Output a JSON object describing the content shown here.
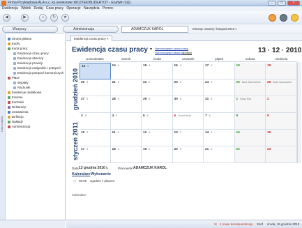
{
  "window": {
    "title": "Firma Przykładowa ALA s.c. ks.serwisowe WOJTEK\\BUDERTOT - EnaWin SQL",
    "buttons": [
      "_",
      "□",
      "×"
    ]
  },
  "menu": {
    "items": [
      "Ewidencja",
      "Widok",
      "Dodaj",
      "Czas pracy",
      "Operacje",
      "Narzędzia",
      "Pomoc"
    ]
  },
  "addressbar": {
    "left_pill": "Wszyscy",
    "section": "Administracja",
    "person": "ADAMCZUK KAROL",
    "period_label": "Miesiąc otwarty: listopad 2010 r."
  },
  "sidebar": {
    "items": [
      {
        "label": "Strona główna",
        "level": 0
      },
      {
        "label": "Kadry",
        "level": 0
      },
      {
        "label": "Karta pracy",
        "level": 0
      },
      {
        "label": "Ewidencja czasu pracy",
        "level": 1
      },
      {
        "label": "Ewidencja absencji",
        "level": 1
      },
      {
        "label": "Ewidencja prowizji",
        "level": 1
      },
      {
        "label": "Ewidencja nadgodzin i potrąceń",
        "level": 1
      },
      {
        "label": "Ewidencja potrąceń komorniczych",
        "level": 1
      },
      {
        "label": "Płace",
        "level": 0
      },
      {
        "label": "Wypłaty",
        "level": 1
      },
      {
        "label": "Rachunki",
        "level": 1
      },
      {
        "label": "Ewidencje dodatkowe",
        "level": 0
      },
      {
        "label": "Finanse",
        "level": 0
      },
      {
        "label": "Kartoteki",
        "level": 0
      },
      {
        "label": "Deklaracje",
        "level": 0
      },
      {
        "label": "Zestawienia",
        "level": 0
      },
      {
        "label": "Definicje",
        "level": 0
      },
      {
        "label": "Nakłady",
        "level": 0
      },
      {
        "label": "Administracja",
        "level": 0
      }
    ],
    "rail_label": "Lista modułów"
  },
  "tabs": [
    {
      "label": "Ewidencja czasu pracy"
    }
  ],
  "header": {
    "title": "Ewidencja czasu pracy",
    "dropdown": "▾",
    "link1": "Harmonogram czasu pracy",
    "link2": "Harmonogram absencji",
    "filter": "Zmiany",
    "date_nav": "13 · 12 · 2010"
  },
  "calendar": {
    "days": [
      "poniedziałek",
      "wtorek",
      "środa",
      "czwartek",
      "piątek",
      "sobota",
      "niedziela"
    ],
    "months": [
      {
        "label": "grudzień 2010",
        "rows": 3
      },
      {
        "label": "styczeń 2011",
        "rows": 3
      }
    ],
    "weeks": [
      [
        {
          "d": "13",
          "t": "8"
        },
        {
          "d": "14",
          "t": "8"
        },
        {
          "d": "15",
          "t": "8"
        },
        {
          "d": "16",
          "t": "8"
        },
        {
          "d": "17",
          "t": "8"
        },
        {
          "d": "18",
          "t": ""
        },
        {
          "d": "19",
          "t": ""
        }
      ],
      [
        {
          "d": "20",
          "t": "8"
        },
        {
          "d": "21",
          "t": "8"
        },
        {
          "d": "22",
          "t": "8"
        },
        {
          "d": "23",
          "t": "8"
        },
        {
          "d": "24",
          "t": "8"
        },
        {
          "d": "25",
          "t": "Boże Narodzenie"
        },
        {
          "d": "26",
          "t": "Boże Narodzenie"
        }
      ],
      [
        {
          "d": "27",
          "t": "8"
        },
        {
          "d": "28",
          "t": "8"
        },
        {
          "d": "29",
          "t": "8"
        },
        {
          "d": "30",
          "t": "8"
        },
        {
          "d": "31",
          "t": "8"
        },
        {
          "d": "1",
          "t": "Nowy Rok"
        },
        {
          "d": "2",
          "t": ""
        }
      ],
      [
        {
          "d": "3",
          "t": "8"
        },
        {
          "d": "4",
          "t": "8"
        },
        {
          "d": "5",
          "t": "8"
        },
        {
          "d": "6",
          "t": "Trzech Króli"
        },
        {
          "d": "7",
          "t": "8"
        },
        {
          "d": "8",
          "t": ""
        },
        {
          "d": "9",
          "t": ""
        }
      ],
      [
        {
          "d": "10",
          "t": "8"
        },
        {
          "d": "11",
          "t": "8"
        },
        {
          "d": "12",
          "t": "8"
        },
        {
          "d": "13",
          "t": "8"
        },
        {
          "d": "14",
          "t": "8"
        },
        {
          "d": "15",
          "t": ""
        },
        {
          "d": "16",
          "t": ""
        }
      ],
      [
        {
          "d": "17",
          "t": "8"
        },
        {
          "d": "18",
          "t": "8"
        },
        {
          "d": "19",
          "t": "8"
        },
        {
          "d": "20",
          "t": "8"
        },
        {
          "d": "21",
          "t": "8"
        },
        {
          "d": "22",
          "t": ""
        },
        {
          "d": "23",
          "t": ""
        }
      ]
    ]
  },
  "detail": {
    "date_label": "Data:",
    "date_value": "13 grudnia 2010 r.",
    "employee_label": "Pracownik:",
    "employee_value": "ADAMCZUK KAROL",
    "tab1": "Kalendarz",
    "tab2": "Wykonanie",
    "row_time": "08:00",
    "row_text": "zgodnie z planem",
    "notes_label": "Kalendarz"
  },
  "status": {
    "alert": "1 nowa korespondencja",
    "user": "Szef",
    "date": "środa, 15 grudnia 2010"
  },
  "colors": {
    "accent": "#1f3f6d",
    "weekend_sun": "#d21f1f",
    "weekend_sat": "#2a9a2a",
    "selection": "#cfe0f6"
  }
}
